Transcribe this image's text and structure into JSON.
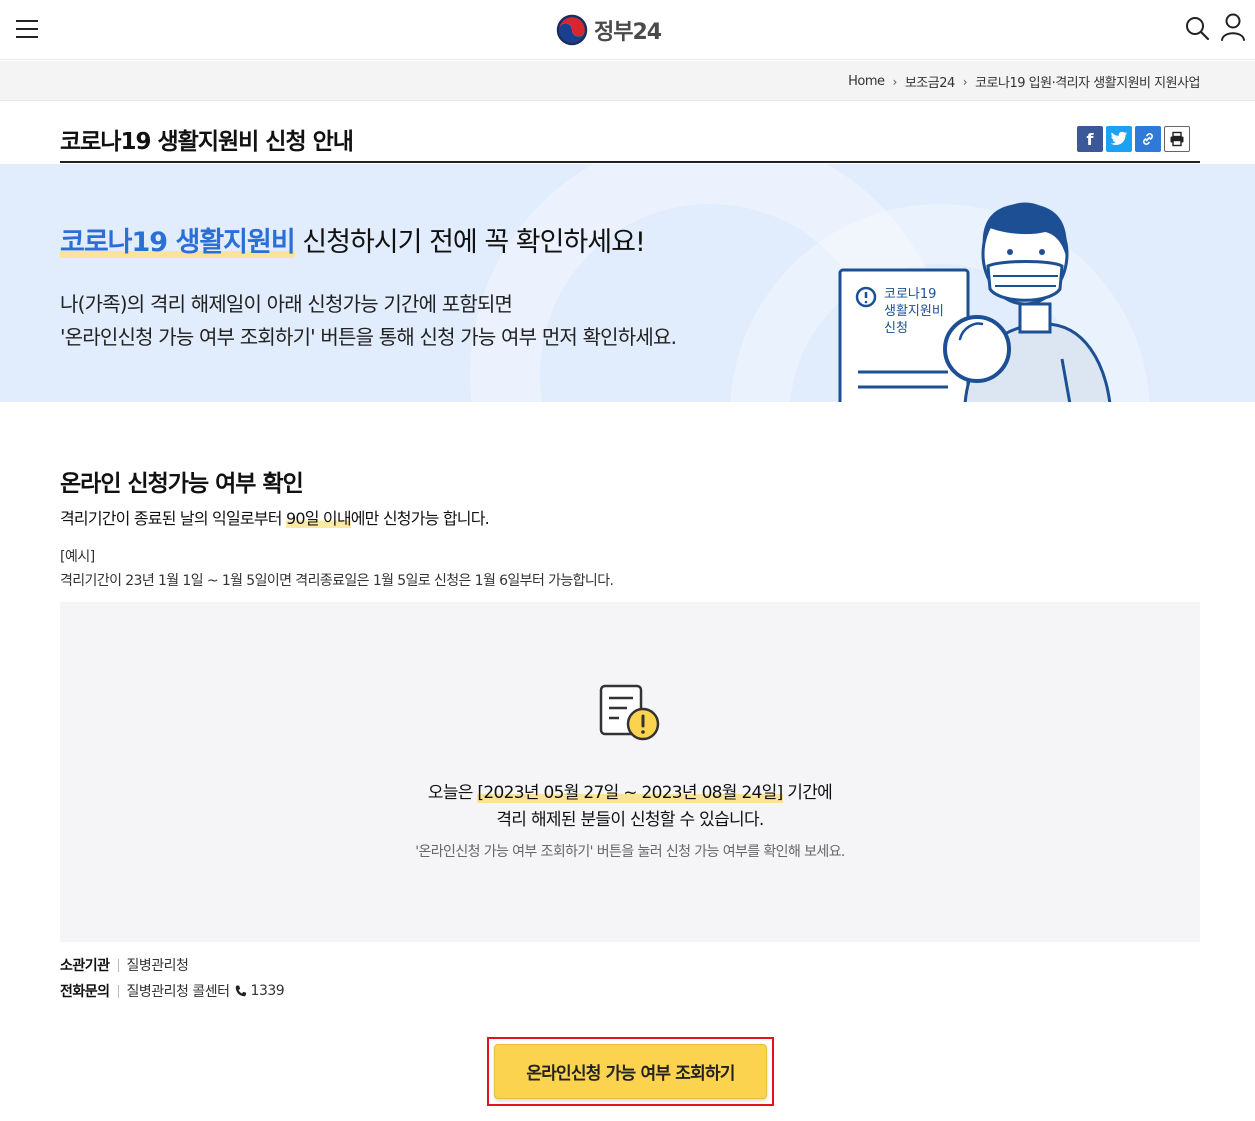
{
  "header": {
    "logo_text": "정부24"
  },
  "breadcrumb": {
    "items": [
      "Home",
      "보조금24",
      "코로나19 입원·격리자 생활지원비 지원사업"
    ]
  },
  "page": {
    "title": "코로나19 생활지원비 신청 안내"
  },
  "share": {
    "facebook": "f"
  },
  "banner": {
    "headline_highlight": "코로나19 생활지원비",
    "headline_rest": " 신청하시기 전에 꼭 확인하세요!",
    "line1": "나(가족)의 격리 해제일이 아래 신청가능 기간에 포함되면",
    "line2": "'온라인신청 가능 여부 조회하기' 버튼을 통해 신청 가능 여부 먼저 확인하세요.",
    "illustration_doc_text": [
      "코로나19",
      "생활지원비",
      "신청"
    ]
  },
  "section": {
    "title": "온라인 신청가능 여부 확인",
    "desc_before": "격리기간이 종료된 날의 익일로부터 ",
    "desc_highlight": "90일 이내",
    "desc_after": "에만 신청가능 합니다.",
    "example_label": "[예시]",
    "example_text": "격리기간이 23년 1월 1일 ~ 1월 5일이면 격리종료일은 1월 5일로 신청은 1월 6일부터 가능합니다."
  },
  "info": {
    "line1_before": "오늘은 ",
    "line1_highlight": "[2023년 05월 27일 ~ 2023년 08월 24일]",
    "line1_after": " 기간에",
    "line2": "격리 해제된 분들이 신청할 수 있습니다.",
    "line3": "'온라인신청 가능 여부 조회하기' 버튼을 눌러 신청 가능 여부를 확인해 보세요."
  },
  "meta": {
    "agency_label": "소관기관",
    "agency_value": "질병관리청",
    "contact_label": "전화문의",
    "contact_value": "질병관리청 콜센터",
    "phone": "1339"
  },
  "cta": {
    "label": "온라인신청 가능 여부 조회하기"
  },
  "colors": {
    "accent_blue": "#2a6fd6",
    "banner_bg": "#e1ecfc",
    "cta_yellow": "#fcd34f",
    "highlight_yellow": "#fbe39a",
    "outline_red": "#e0141e"
  }
}
